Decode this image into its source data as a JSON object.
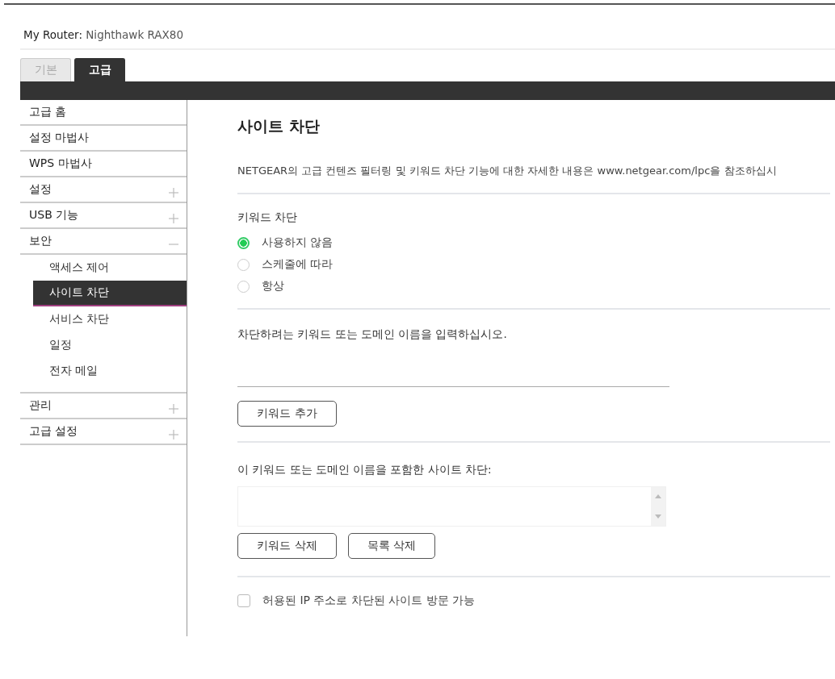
{
  "header": {
    "label": "My Router:",
    "model": "Nighthawk RAX80"
  },
  "tabs": [
    {
      "label": "기본",
      "selected": false
    },
    {
      "label": "고급",
      "selected": true
    }
  ],
  "sidebar": {
    "items": [
      {
        "label": "고급 홈",
        "kind": "link"
      },
      {
        "label": "설정 마법사",
        "kind": "link"
      },
      {
        "label": "WPS 마법사",
        "kind": "link"
      },
      {
        "label": "설정",
        "kind": "group",
        "expanded": false
      },
      {
        "label": "USB 기능",
        "kind": "group",
        "expanded": false
      },
      {
        "label": "보안",
        "kind": "group",
        "expanded": true,
        "children": [
          {
            "label": "액세스 제어",
            "selected": false
          },
          {
            "label": "사이트 차단",
            "selected": true
          },
          {
            "label": "서비스 차단",
            "selected": false
          },
          {
            "label": "일정",
            "selected": false
          },
          {
            "label": "전자 메일",
            "selected": false
          }
        ]
      },
      {
        "label": "관리",
        "kind": "group",
        "expanded": false
      },
      {
        "label": "고급 설정",
        "kind": "group",
        "expanded": false
      }
    ]
  },
  "page": {
    "title": "사이트 차단",
    "description": "NETGEAR의 고급 컨텐즈 필터링 및 키워드 차단 기능에 대한 자세한 내용은 www.netgear.com/lpc을 참조하십시",
    "keyword_blocking": {
      "label": "키워드 차단",
      "options": [
        {
          "label": "사용하지 않음",
          "selected": true
        },
        {
          "label": "스케줄에 따라",
          "selected": false
        },
        {
          "label": "항상",
          "selected": false
        }
      ]
    },
    "keyword_prompt": "차단하려는 키워드 또는 도메인 이름을 입력하십시오.",
    "add_button": "키워드 추가",
    "list_label": "이 키워드 또는 도메인 이름을 포함한 사이트 차단:",
    "list_buttons": [
      "키워드 삭제",
      "목록 삭제"
    ],
    "allow_trusted": {
      "label": "허용된 IP 주소로 차단된 사이트 방문 가능",
      "checked": false
    }
  }
}
